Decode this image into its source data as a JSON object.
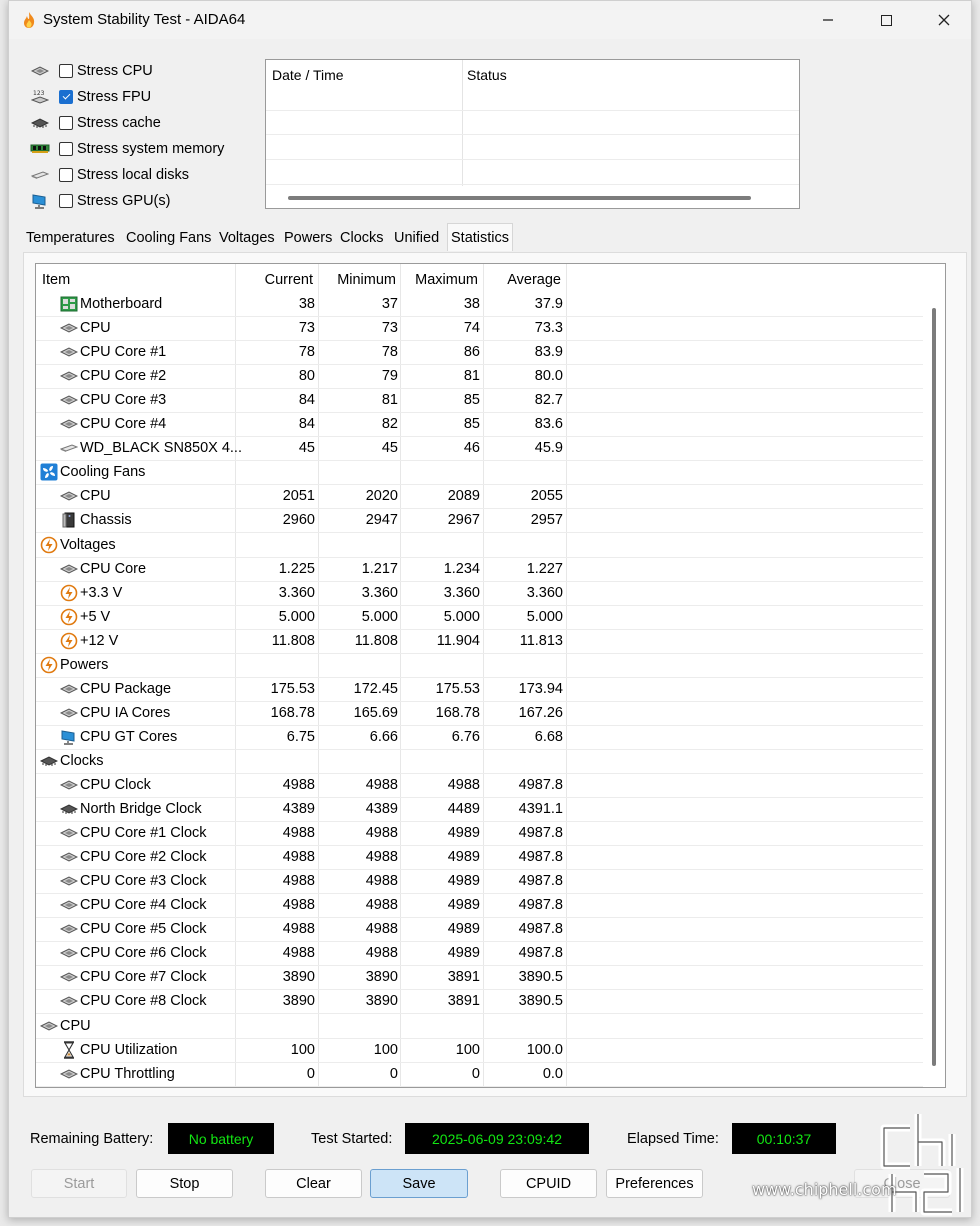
{
  "window": {
    "title": "System Stability Test - AIDA64"
  },
  "stress_options": [
    {
      "label": "Stress CPU",
      "checked": false,
      "icon": "cpu-chip-icon"
    },
    {
      "label": "Stress FPU",
      "checked": true,
      "icon": "fpu-icon"
    },
    {
      "label": "Stress cache",
      "checked": false,
      "icon": "cache-chip-icon"
    },
    {
      "label": "Stress system memory",
      "checked": false,
      "icon": "memory-module-icon"
    },
    {
      "label": "Stress local disks",
      "checked": false,
      "icon": "disk-drive-icon"
    },
    {
      "label": "Stress GPU(s)",
      "checked": false,
      "icon": "monitor-icon"
    }
  ],
  "log": {
    "col_datetime": "Date / Time",
    "col_status": "Status"
  },
  "tabs": [
    "Temperatures",
    "Cooling Fans",
    "Voltages",
    "Powers",
    "Clocks",
    "Unified",
    "Statistics"
  ],
  "active_tab": "Statistics",
  "grid": {
    "headers": {
      "item": "Item",
      "current": "Current",
      "minimum": "Minimum",
      "maximum": "Maximum",
      "average": "Average"
    },
    "rows": [
      {
        "type": "item",
        "label": "Motherboard",
        "icon": "motherboard-icon",
        "current": "38",
        "minimum": "37",
        "maximum": "38",
        "average": "37.9"
      },
      {
        "type": "item",
        "label": "CPU",
        "icon": "cpu-chip-icon",
        "current": "73",
        "minimum": "73",
        "maximum": "74",
        "average": "73.3"
      },
      {
        "type": "item",
        "label": "CPU Core #1",
        "icon": "cpu-chip-icon",
        "current": "78",
        "minimum": "78",
        "maximum": "86",
        "average": "83.9"
      },
      {
        "type": "item",
        "label": "CPU Core #2",
        "icon": "cpu-chip-icon",
        "current": "80",
        "minimum": "79",
        "maximum": "81",
        "average": "80.0"
      },
      {
        "type": "item",
        "label": "CPU Core #3",
        "icon": "cpu-chip-icon",
        "current": "84",
        "minimum": "81",
        "maximum": "85",
        "average": "82.7"
      },
      {
        "type": "item",
        "label": "CPU Core #4",
        "icon": "cpu-chip-icon",
        "current": "84",
        "minimum": "82",
        "maximum": "85",
        "average": "83.6"
      },
      {
        "type": "item",
        "label": "WD_BLACK SN850X 4...",
        "icon": "disk-drive-icon",
        "current": "45",
        "minimum": "45",
        "maximum": "46",
        "average": "45.9"
      },
      {
        "type": "group",
        "label": "Cooling Fans",
        "icon": "fan-icon"
      },
      {
        "type": "item",
        "label": "CPU",
        "icon": "cpu-chip-icon",
        "current": "2051",
        "minimum": "2020",
        "maximum": "2089",
        "average": "2055"
      },
      {
        "type": "item",
        "label": "Chassis",
        "icon": "chassis-icon",
        "current": "2960",
        "minimum": "2947",
        "maximum": "2967",
        "average": "2957"
      },
      {
        "type": "group",
        "label": "Voltages",
        "icon": "voltage-icon"
      },
      {
        "type": "item",
        "label": "CPU Core",
        "icon": "cpu-chip-icon",
        "current": "1.225",
        "minimum": "1.217",
        "maximum": "1.234",
        "average": "1.227"
      },
      {
        "type": "item",
        "label": "+3.3 V",
        "icon": "voltage-icon",
        "current": "3.360",
        "minimum": "3.360",
        "maximum": "3.360",
        "average": "3.360"
      },
      {
        "type": "item",
        "label": "+5 V",
        "icon": "voltage-icon",
        "current": "5.000",
        "minimum": "5.000",
        "maximum": "5.000",
        "average": "5.000"
      },
      {
        "type": "item",
        "label": "+12 V",
        "icon": "voltage-icon",
        "current": "11.808",
        "minimum": "11.808",
        "maximum": "11.904",
        "average": "11.813"
      },
      {
        "type": "group",
        "label": "Powers",
        "icon": "voltage-icon"
      },
      {
        "type": "item",
        "label": "CPU Package",
        "icon": "cpu-chip-icon",
        "current": "175.53",
        "minimum": "172.45",
        "maximum": "175.53",
        "average": "173.94"
      },
      {
        "type": "item",
        "label": "CPU IA Cores",
        "icon": "cpu-chip-icon",
        "current": "168.78",
        "minimum": "165.69",
        "maximum": "168.78",
        "average": "167.26"
      },
      {
        "type": "item",
        "label": "CPU GT Cores",
        "icon": "monitor-icon",
        "current": "6.75",
        "minimum": "6.66",
        "maximum": "6.76",
        "average": "6.68"
      },
      {
        "type": "group",
        "label": "Clocks",
        "icon": "cache-chip-icon"
      },
      {
        "type": "item",
        "label": "CPU Clock",
        "icon": "cpu-chip-icon",
        "current": "4988",
        "minimum": "4988",
        "maximum": "4988",
        "average": "4987.8"
      },
      {
        "type": "item",
        "label": "North Bridge Clock",
        "icon": "cache-chip-icon",
        "current": "4389",
        "minimum": "4389",
        "maximum": "4489",
        "average": "4391.1"
      },
      {
        "type": "item",
        "label": "CPU Core #1 Clock",
        "icon": "cpu-chip-icon",
        "current": "4988",
        "minimum": "4988",
        "maximum": "4989",
        "average": "4987.8"
      },
      {
        "type": "item",
        "label": "CPU Core #2 Clock",
        "icon": "cpu-chip-icon",
        "current": "4988",
        "minimum": "4988",
        "maximum": "4989",
        "average": "4987.8"
      },
      {
        "type": "item",
        "label": "CPU Core #3 Clock",
        "icon": "cpu-chip-icon",
        "current": "4988",
        "minimum": "4988",
        "maximum": "4989",
        "average": "4987.8"
      },
      {
        "type": "item",
        "label": "CPU Core #4 Clock",
        "icon": "cpu-chip-icon",
        "current": "4988",
        "minimum": "4988",
        "maximum": "4989",
        "average": "4987.8"
      },
      {
        "type": "item",
        "label": "CPU Core #5 Clock",
        "icon": "cpu-chip-icon",
        "current": "4988",
        "minimum": "4988",
        "maximum": "4989",
        "average": "4987.8"
      },
      {
        "type": "item",
        "label": "CPU Core #6 Clock",
        "icon": "cpu-chip-icon",
        "current": "4988",
        "minimum": "4988",
        "maximum": "4989",
        "average": "4987.8"
      },
      {
        "type": "item",
        "label": "CPU Core #7 Clock",
        "icon": "cpu-chip-icon",
        "current": "3890",
        "minimum": "3890",
        "maximum": "3891",
        "average": "3890.5"
      },
      {
        "type": "item",
        "label": "CPU Core #8 Clock",
        "icon": "cpu-chip-icon",
        "current": "3890",
        "minimum": "3890",
        "maximum": "3891",
        "average": "3890.5"
      },
      {
        "type": "group",
        "label": "CPU",
        "icon": "cpu-chip-icon"
      },
      {
        "type": "item",
        "label": "CPU Utilization",
        "icon": "hourglass-icon",
        "current": "100",
        "minimum": "100",
        "maximum": "100",
        "average": "100.0"
      },
      {
        "type": "item",
        "label": "CPU Throttling",
        "icon": "cpu-chip-icon",
        "current": "0",
        "minimum": "0",
        "maximum": "0",
        "average": "0.0"
      }
    ]
  },
  "status": {
    "battery_label": "Remaining Battery:",
    "battery_value": "No battery",
    "started_label": "Test Started:",
    "started_value": "2025-06-09 23:09:42",
    "elapsed_label": "Elapsed Time:",
    "elapsed_value": "00:10:37",
    "lcd_text_color": "#12e612"
  },
  "buttons": {
    "start": "Start",
    "stop": "Stop",
    "clear": "Clear",
    "save": "Save",
    "cpuid": "CPUID",
    "preferences": "Preferences",
    "close": "Close"
  },
  "watermark": {
    "url": "www.chiphell.com"
  }
}
